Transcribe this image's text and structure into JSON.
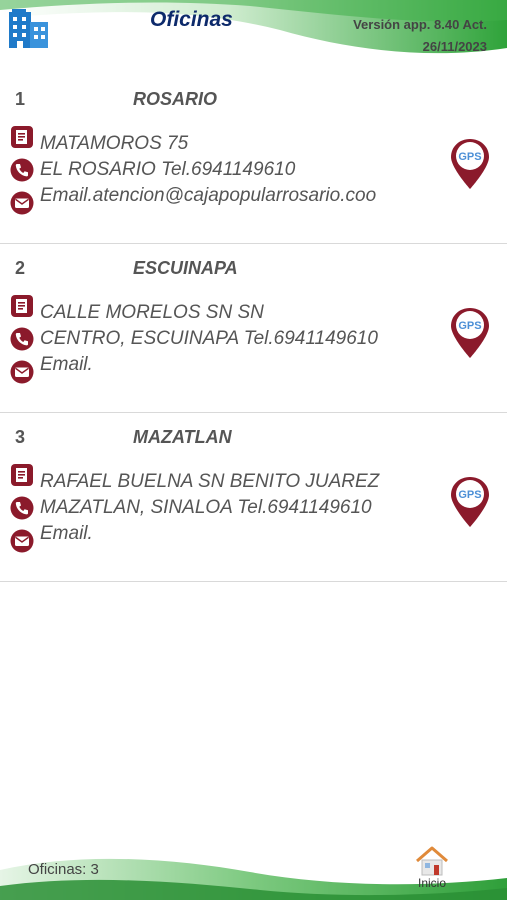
{
  "header": {
    "title": "Oficinas",
    "version_line1": "Versión app. 8.40 Act.",
    "version_line2": "26/11/2023",
    "icon": "building-icon"
  },
  "offices": [
    {
      "number": "1",
      "name": "ROSARIO",
      "address": "MATAMOROS 75",
      "phone_line": "EL ROSARIO Tel.6941149610",
      "email_line": "Email.atencion@cajapopularrosario.coo",
      "gps_label": "GPS"
    },
    {
      "number": "2",
      "name": "ESCUINAPA",
      "address": "CALLE MORELOS SN SN",
      "phone_line": "CENTRO, ESCUINAPA Tel.6941149610",
      "email_line": "Email.",
      "gps_label": "GPS"
    },
    {
      "number": "3",
      "name": "MAZATLAN",
      "address": "RAFAEL BUELNA SN BENITO JUAREZ",
      "phone_line": "MAZATLAN, SINALOA Tel.6941149610",
      "email_line": "Email.",
      "gps_label": "GPS"
    }
  ],
  "footer": {
    "count_text": "Oficinas: 3",
    "home_label": "Inicio"
  },
  "colors": {
    "title": "#0d2a6b",
    "accent_green": "#2e9e3a",
    "icon_red": "#8b1a2b",
    "text_gray": "#555555"
  }
}
